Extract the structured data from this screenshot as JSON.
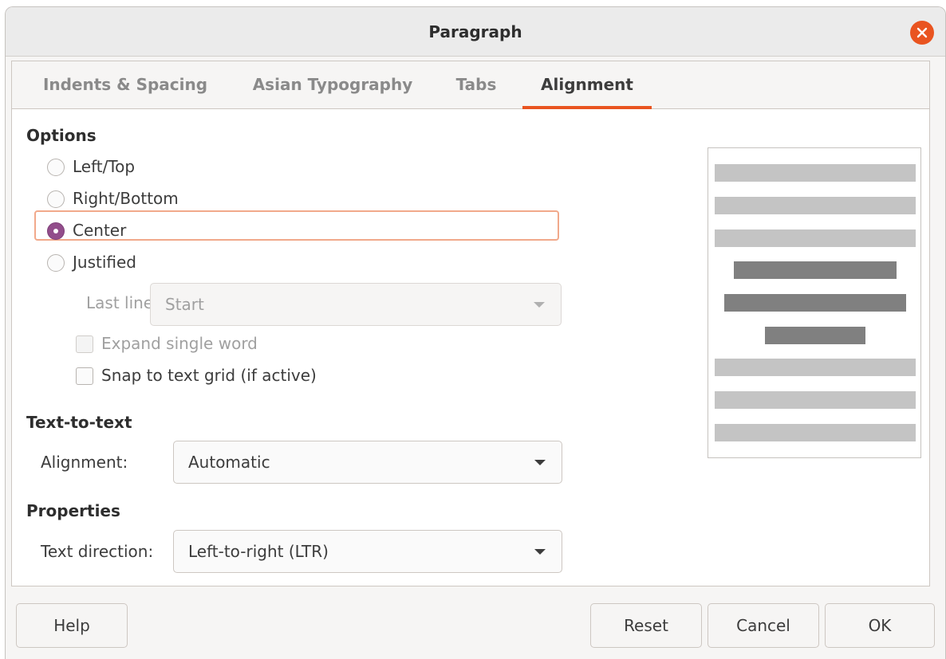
{
  "window": {
    "title": "Paragraph"
  },
  "tabs": [
    {
      "label": "Indents & Spacing",
      "active": false
    },
    {
      "label": "Asian Typography",
      "active": false
    },
    {
      "label": "Tabs",
      "active": false
    },
    {
      "label": "Alignment",
      "active": true
    }
  ],
  "options": {
    "heading": "Options",
    "radios": [
      {
        "label": "Left/Top",
        "checked": false
      },
      {
        "label": "Right/Bottom",
        "checked": false
      },
      {
        "label": "Center",
        "checked": true
      },
      {
        "label": "Justified",
        "checked": false
      }
    ],
    "last_line_label": "Last line:",
    "last_line_value": "Start",
    "expand_single_word": {
      "label": "Expand single word",
      "checked": false,
      "enabled": false
    },
    "snap_to_grid": {
      "label": "Snap to text grid (if active)",
      "checked": false,
      "enabled": true
    }
  },
  "text_to_text": {
    "heading": "Text-to-text",
    "alignment_label": "Alignment:",
    "alignment_value": "Automatic"
  },
  "properties": {
    "heading": "Properties",
    "direction_label": "Text direction:",
    "direction_value": "Left-to-right (LTR)"
  },
  "buttons": {
    "help": "Help",
    "reset": "Reset",
    "cancel": "Cancel",
    "ok": "OK"
  },
  "colors": {
    "accent": "#e95420",
    "radio_checked": "#924d8b",
    "preview_light": "#c4c4c4",
    "preview_dark": "#808080"
  }
}
